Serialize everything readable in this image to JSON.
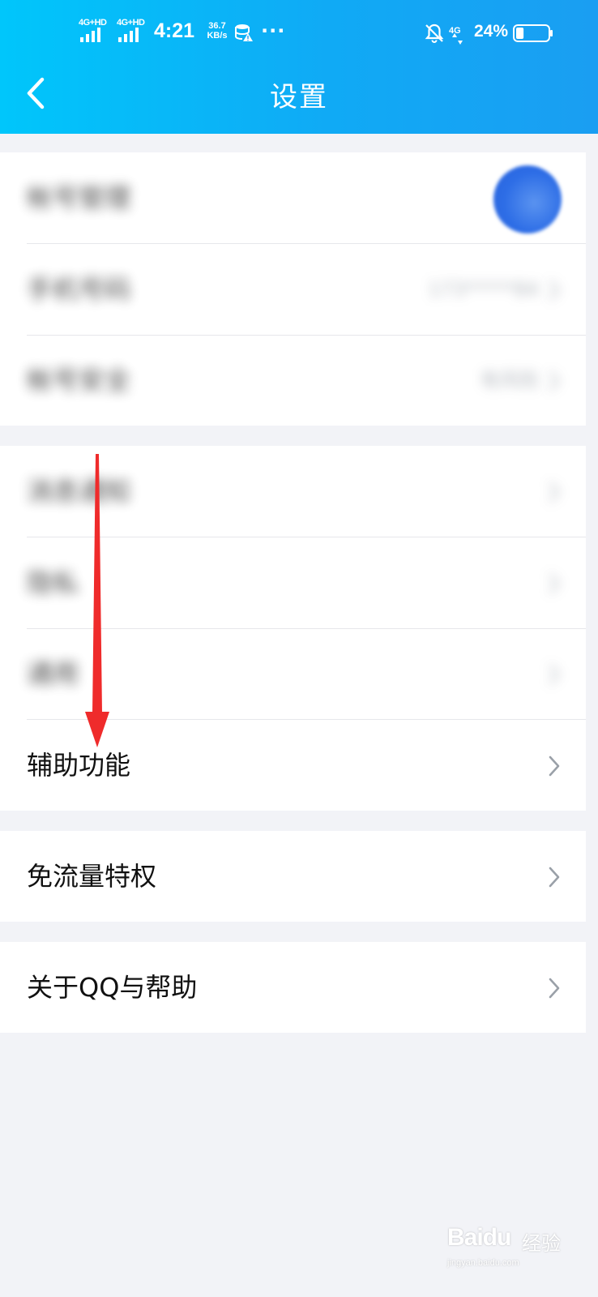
{
  "status_bar": {
    "sim1_label": "4G+HD",
    "sim2_label": "4G+HD",
    "time": "4:21",
    "speed_value": "36.7",
    "speed_unit": "KB/s",
    "more": "···",
    "network_label": "4G",
    "battery_percent": "24%",
    "battery_level": 0.24,
    "icons": [
      "signal-icon",
      "signal-icon",
      "data-usage-icon",
      "bell-off-icon",
      "battery-icon"
    ]
  },
  "header": {
    "title": "设置",
    "back_icon": "chevron-left-icon",
    "colors": {
      "gradient_start": "#00c6fb",
      "gradient_end": "#1a9ef2"
    }
  },
  "settings": {
    "group1": [
      {
        "label": "帐号管理",
        "value": "",
        "blurred": true
      },
      {
        "label": "手机号码",
        "value": "173*****84",
        "blurred": true
      },
      {
        "label": "帐号安全",
        "value": "有风险",
        "blurred": true
      }
    ],
    "group2": [
      {
        "label": "消息通知",
        "blurred": true
      },
      {
        "label": "隐私",
        "blurred": true
      },
      {
        "label": "通用",
        "blurred": true
      },
      {
        "label": "辅助功能",
        "blurred": false
      }
    ],
    "group3": [
      {
        "label": "免流量特权"
      }
    ],
    "group4": [
      {
        "label": "关于QQ与帮助"
      }
    ]
  },
  "annotation": {
    "arrow_color": "#ef2b2b",
    "points_to": "辅助功能"
  },
  "watermark": {
    "brand": "Baidu",
    "cn": "经验",
    "url": "jingyan.baidu.com"
  }
}
